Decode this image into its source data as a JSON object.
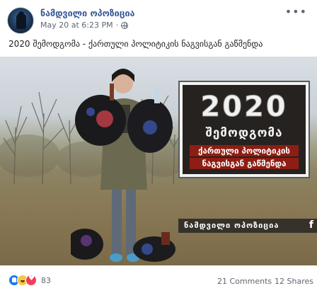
{
  "post": {
    "page_name": "ნამდვილი ოპოზიცია",
    "date": "May 20 at 6:23 PM",
    "separator": "·",
    "privacy_icon": "globe-icon",
    "more_icon": "more-options-icon",
    "text": "2020 შემოდგომა - ქართული პოლიტიკის ნაგვისგან გაწმენდა"
  },
  "image": {
    "sign_year": "2020",
    "sign_season": "შემოდგომა",
    "sign_line1": "ქართული პოლიტიკის",
    "sign_line2": "ნაგვისგან გაწმენდა",
    "watermark": "ნამდვილი ოპოზიცია",
    "watermark_logo": "f"
  },
  "stats": {
    "reaction_icons": [
      "like-icon",
      "haha-icon",
      "love-icon"
    ],
    "reactions_count": "83",
    "comments": "21 Comments",
    "shares": "12 Shares"
  },
  "colors": {
    "link_blue": "#385898",
    "like_blue": "#2078f4",
    "love_red": "#f33e58",
    "haha_yellow": "#f7c640",
    "sign_red": "#8e1d13"
  }
}
